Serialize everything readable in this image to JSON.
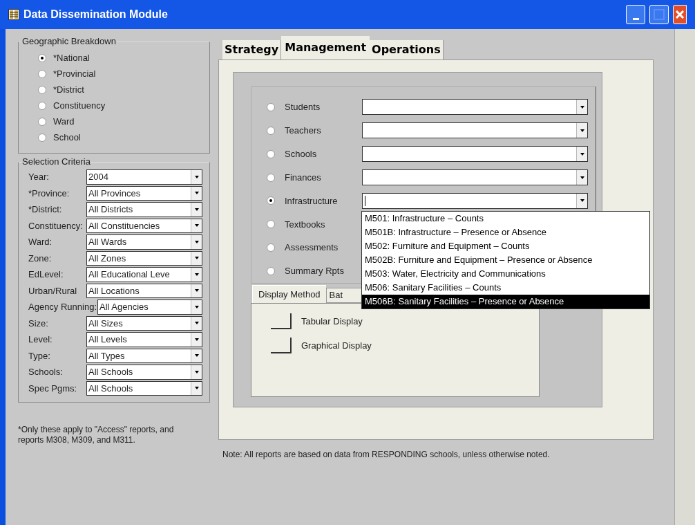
{
  "window": {
    "title": "Data Dissemination Module"
  },
  "geographic_breakdown": {
    "title": "Geographic Breakdown",
    "options": [
      {
        "label": "*National",
        "selected": true
      },
      {
        "label": "*Provincial",
        "selected": false
      },
      {
        "label": "*District",
        "selected": false
      },
      {
        "label": "Constituency",
        "selected": false
      },
      {
        "label": "Ward",
        "selected": false
      },
      {
        "label": "School",
        "selected": false
      }
    ]
  },
  "selection_criteria": {
    "title": "Selection Criteria",
    "fields": [
      {
        "label": "Year:",
        "value": "2004"
      },
      {
        "label": "*Province:",
        "value": "All Provinces"
      },
      {
        "label": "*District:",
        "value": "All Districts"
      },
      {
        "label": "Constituency:",
        "value": "All Constituencies"
      },
      {
        "label": "Ward:",
        "value": "All Wards"
      },
      {
        "label": "Zone:",
        "value": "All Zones"
      },
      {
        "label": "EdLevel:",
        "value": "All Educational Leve"
      },
      {
        "label": "Urban/Rural",
        "value": "All Locations"
      },
      {
        "label": "Agency Running:",
        "value": "All Agencies"
      },
      {
        "label": "Size:",
        "value": "All Sizes"
      },
      {
        "label": "Level:",
        "value": "All Levels"
      },
      {
        "label": "Type:",
        "value": "All Types"
      },
      {
        "label": "Schools:",
        "value": "All Schools"
      },
      {
        "label": "Spec Pgms:",
        "value": "All Schools"
      }
    ]
  },
  "footnote": "*Only these apply to \"Access\" reports, and reports M308, M309, and M311.",
  "tabs": [
    {
      "label": "Strategy",
      "selected": false
    },
    {
      "label": "Management",
      "selected": true
    },
    {
      "label": "Operations",
      "selected": false
    }
  ],
  "report_types": [
    {
      "label": "Students",
      "selected": false,
      "kind": "combo"
    },
    {
      "label": "Teachers",
      "selected": false,
      "kind": "combo"
    },
    {
      "label": "Schools",
      "selected": false,
      "kind": "combo"
    },
    {
      "label": "Finances",
      "selected": false,
      "kind": "combo"
    },
    {
      "label": "Infrastructure",
      "selected": true,
      "kind": "combo",
      "expanded": true,
      "options": [
        {
          "label": "M501: Infrastructure – Counts",
          "selected": false
        },
        {
          "label": "M501B: Infrastructure – Presence or Absence",
          "selected": false
        },
        {
          "label": "M502: Furniture and Equipment – Counts",
          "selected": false
        },
        {
          "label": "M502B: Furniture and Equipment – Presence or Absence",
          "selected": false
        },
        {
          "label": "M503: Water, Electricity and Communications",
          "selected": false
        },
        {
          "label": "M506: Sanitary Facilities – Counts",
          "selected": false
        },
        {
          "label": "M506B: Sanitary Facilities – Presence or Absence",
          "selected": true
        }
      ]
    },
    {
      "label": "Textbooks",
      "selected": false,
      "kind": "plain"
    },
    {
      "label": "Assessments",
      "selected": false,
      "kind": "plain"
    },
    {
      "label": "Summary Rpts",
      "selected": false,
      "kind": "plain"
    }
  ],
  "output_tabs": [
    {
      "label": "Display Method",
      "selected": true
    },
    {
      "label": "Bat",
      "selected": false
    }
  ],
  "display_buttons": [
    {
      "label": "Tabular Display"
    },
    {
      "label": "Graphical Display"
    }
  ],
  "note": "Note: All reports are based on data from RESPONDING schools, unless otherwise noted."
}
